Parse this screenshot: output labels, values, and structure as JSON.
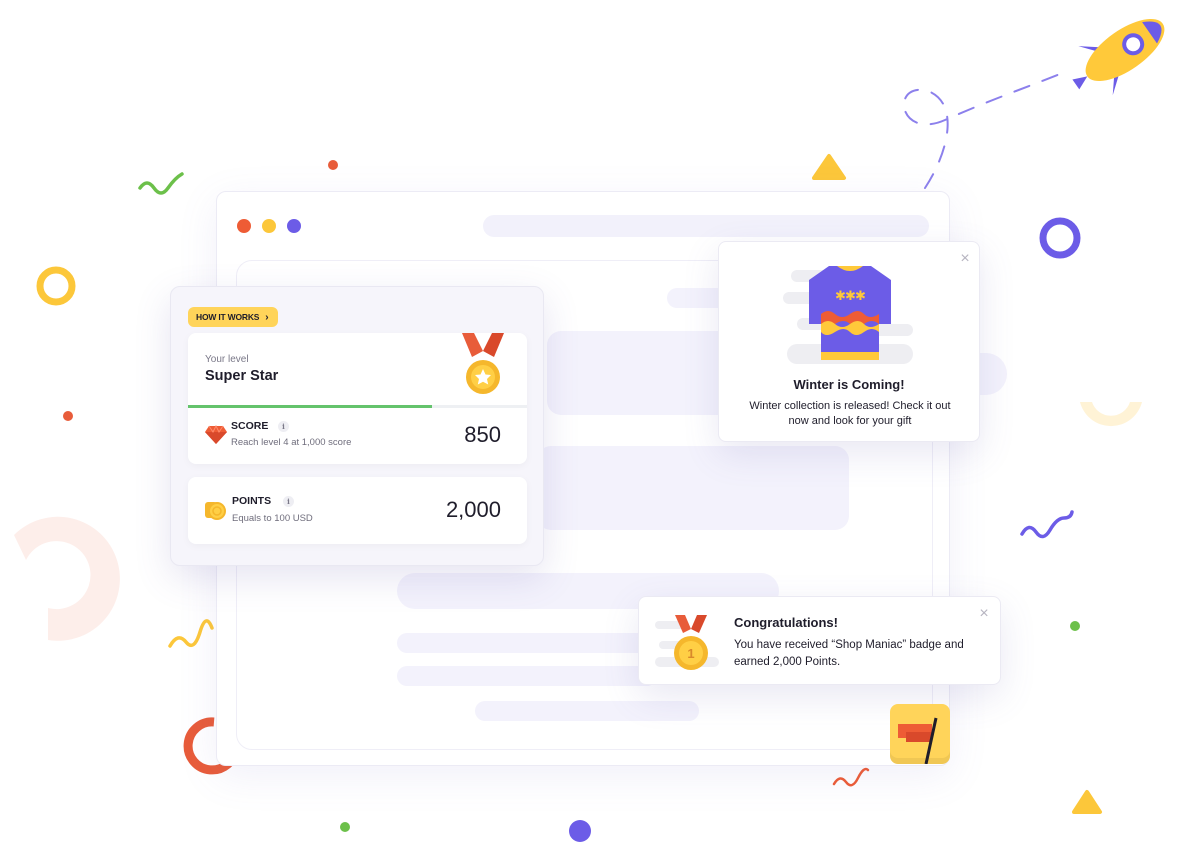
{
  "colors": {
    "primary_purple": "#6c5ce7",
    "yellow": "#ffd45a",
    "orange_red": "#e85c3a",
    "green": "#64c36c",
    "placeholder": "#f3f2fc"
  },
  "browser": {
    "traffic_lights": [
      {
        "name": "red",
        "color": "#ee5c35"
      },
      {
        "name": "yellow",
        "color": "#fcc73a"
      },
      {
        "name": "purple",
        "color": "#6c5ce7"
      }
    ]
  },
  "score_card": {
    "how_it_works_label": "HOW IT WORKS",
    "level": {
      "caption": "Your level",
      "name": "Super Star",
      "icon": "medal-star-icon",
      "progress": 0.72
    },
    "score": {
      "icon": "diamond-icon",
      "title": "SCORE",
      "info_icon": "i",
      "subtitle": "Reach level 4 at 1,000 score",
      "value": "850"
    },
    "points": {
      "icon": "coins-icon",
      "title": "POINTS",
      "info_icon": "i",
      "subtitle": "Equals to 100 USD",
      "value": "2,000"
    }
  },
  "winter_popup": {
    "close_icon": "×",
    "image": "sweater-icon",
    "title": "Winter is Coming!",
    "body": "Winter collection is released! Check it out now and look for your gift"
  },
  "congrats_popup": {
    "close_icon": "×",
    "image": "medal-first-place-icon",
    "medal_number": "1",
    "title": "Congratulations!",
    "body": "You have received “Shop Maniac” badge and earned 2,000 Points."
  },
  "flag_tile": {
    "icon": "flag-icon"
  }
}
